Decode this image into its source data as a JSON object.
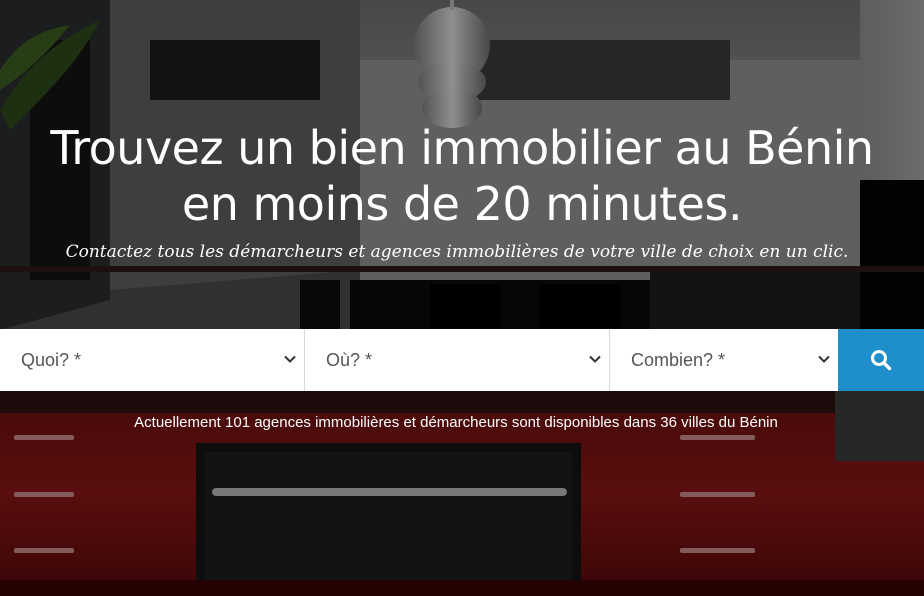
{
  "hero": {
    "headline_line1": "Trouvez un bien immobilier au Bénin",
    "headline_line2": "en moins de 20 minutes.",
    "subtitle": "Contactez tous les démarcheurs et agences immobilières de votre ville de choix en un clic."
  },
  "search": {
    "what_label": "Quoi? *",
    "where_label": "Où? *",
    "budget_label": "Combien? *",
    "button_icon": "search-icon",
    "button_color": "#1e8fca"
  },
  "info_text": "Actuellement 101 agences immobilières et démarcheurs sont disponibles dans 36 villes du Bénin",
  "colors": {
    "accent": "#1e8fca",
    "kitchen_red": "#7a1212"
  }
}
